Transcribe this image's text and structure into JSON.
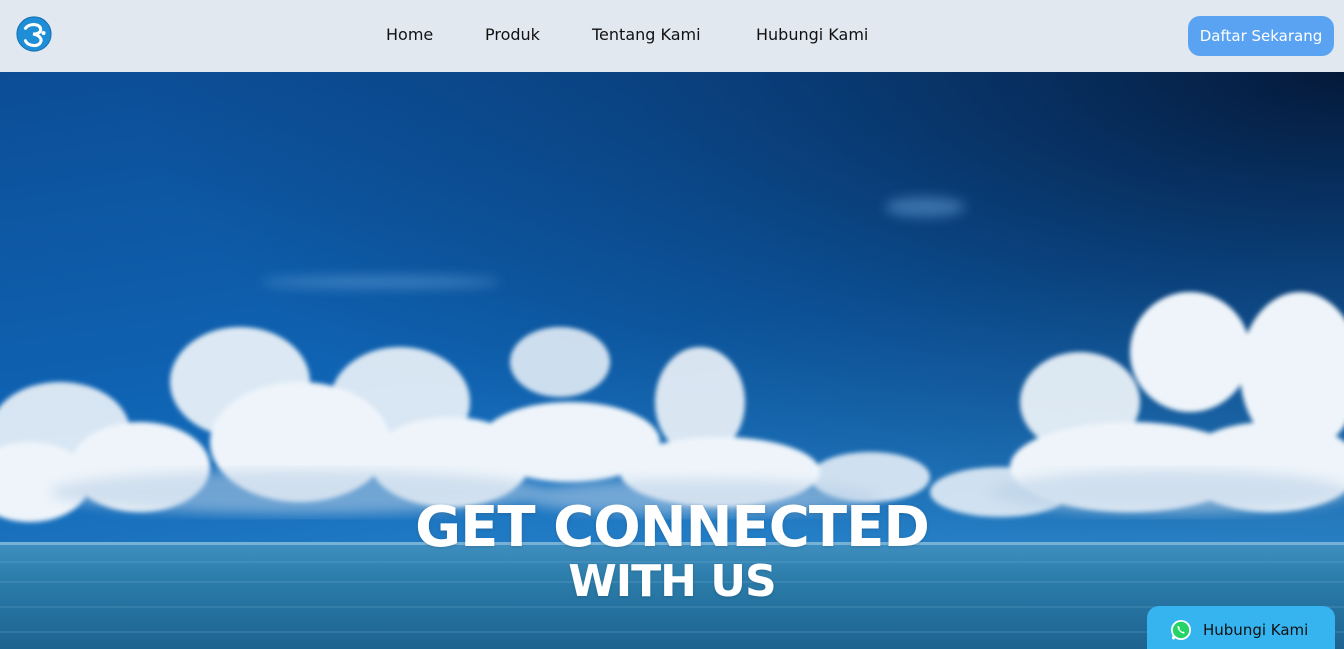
{
  "header": {
    "nav": [
      "Home",
      "Produk",
      "Tentang Kami",
      "Hubungi Kami"
    ],
    "cta_label": "Daftar Sekarang"
  },
  "hero": {
    "title_line1": "GET CONNECTED",
    "title_line2": "WITH US"
  },
  "floating_contact": {
    "label": "Hubungi Kami",
    "icon": "whatsapp-icon"
  },
  "colors": {
    "navbar_bg": "#e2e8f0",
    "cta_bg": "#5aa3f2",
    "contact_bg": "#35b4f0",
    "sky_top": "#06224e",
    "sky_mid": "#0d5aa6"
  }
}
